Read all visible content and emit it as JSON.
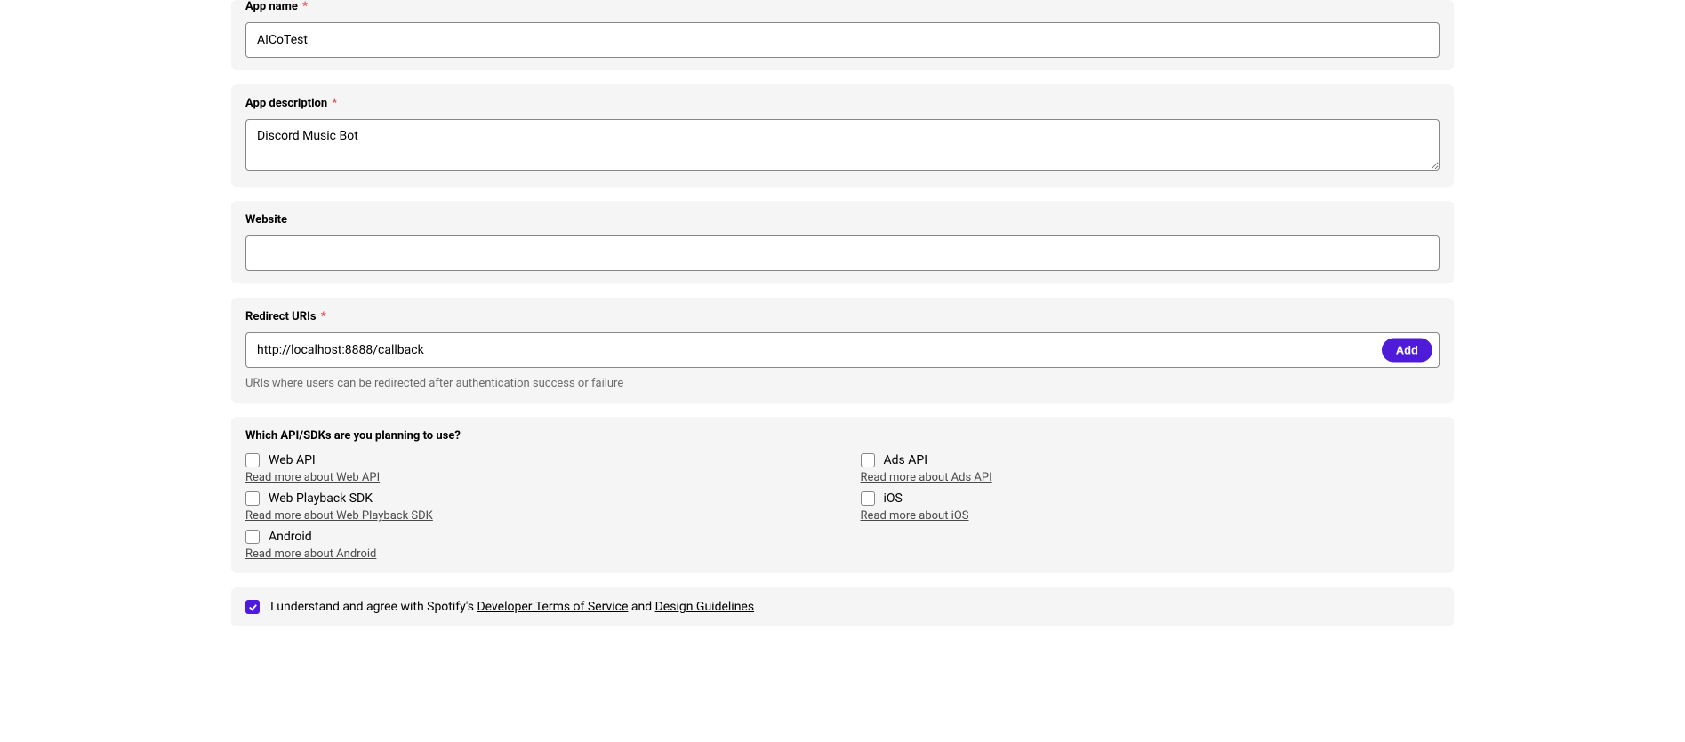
{
  "appName": {
    "label": "App name",
    "required": "*",
    "value": "AICoTest"
  },
  "appDescription": {
    "label": "App description",
    "required": "*",
    "value": "Discord Music Bot"
  },
  "website": {
    "label": "Website",
    "value": ""
  },
  "redirect": {
    "label": "Redirect URIs",
    "required": "*",
    "value": "http://localhost:8888/callback",
    "addLabel": "Add",
    "helper": "URIs where users can be redirected after authentication success or failure"
  },
  "sdks": {
    "heading": "Which API/SDKs are you planning to use?",
    "items": [
      {
        "label": "Web API",
        "link": "Read more about Web API",
        "checked": false
      },
      {
        "label": "Ads API",
        "link": "Read more about Ads API",
        "checked": false
      },
      {
        "label": "Web Playback SDK",
        "link": "Read more about Web Playback SDK",
        "checked": false
      },
      {
        "label": "iOS",
        "link": "Read more about iOS",
        "checked": false
      },
      {
        "label": "Android",
        "link": "Read more about Android",
        "checked": false
      }
    ]
  },
  "terms": {
    "checked": true,
    "prefix": "I understand and agree with Spotify's ",
    "link1": "Developer Terms of Service",
    "middle": " and ",
    "link2": "Design Guidelines"
  }
}
